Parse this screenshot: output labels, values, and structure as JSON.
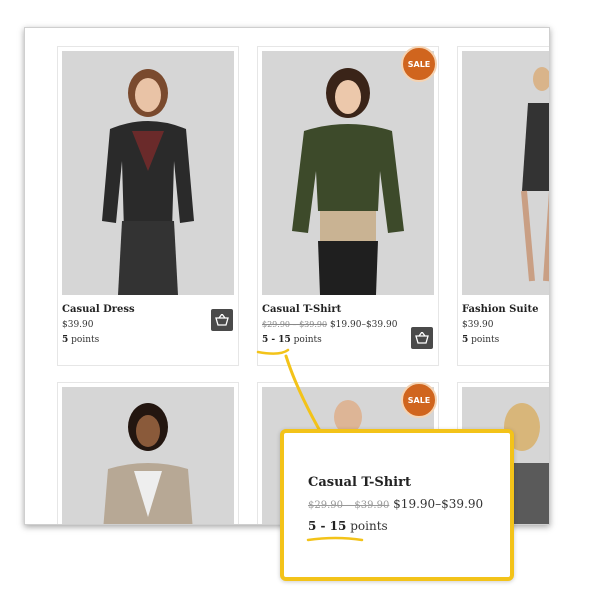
{
  "products": [
    {
      "name": "Casual Dress",
      "price": "$39.90",
      "old_price": "",
      "points_value": "5",
      "points_label": "points",
      "sale": false
    },
    {
      "name": "Casual T-Shirt",
      "price": "$19.90–$39.90",
      "old_price": "$29.90 – $39.90",
      "points_value": "5 - 15",
      "points_label": "points",
      "sale": true,
      "sale_label": "SALE"
    },
    {
      "name": "Fashion Suite",
      "price": "$39.90",
      "old_price": "",
      "points_value": "5",
      "points_label": "points",
      "sale": false
    }
  ],
  "row2": [
    {
      "sale": false
    },
    {
      "sale": true,
      "sale_label": "SALE"
    },
    {
      "sale": false
    }
  ],
  "zoom": {
    "title": "Casual T-Shirt",
    "old_price": "$29.90 – $39.90",
    "price": "$19.90–$39.90",
    "points_value": "5 - 15",
    "points_label": "points"
  },
  "colors": {
    "accent": "#f3c319",
    "sale": "#d0651e",
    "cart": "#4a4a4a"
  }
}
